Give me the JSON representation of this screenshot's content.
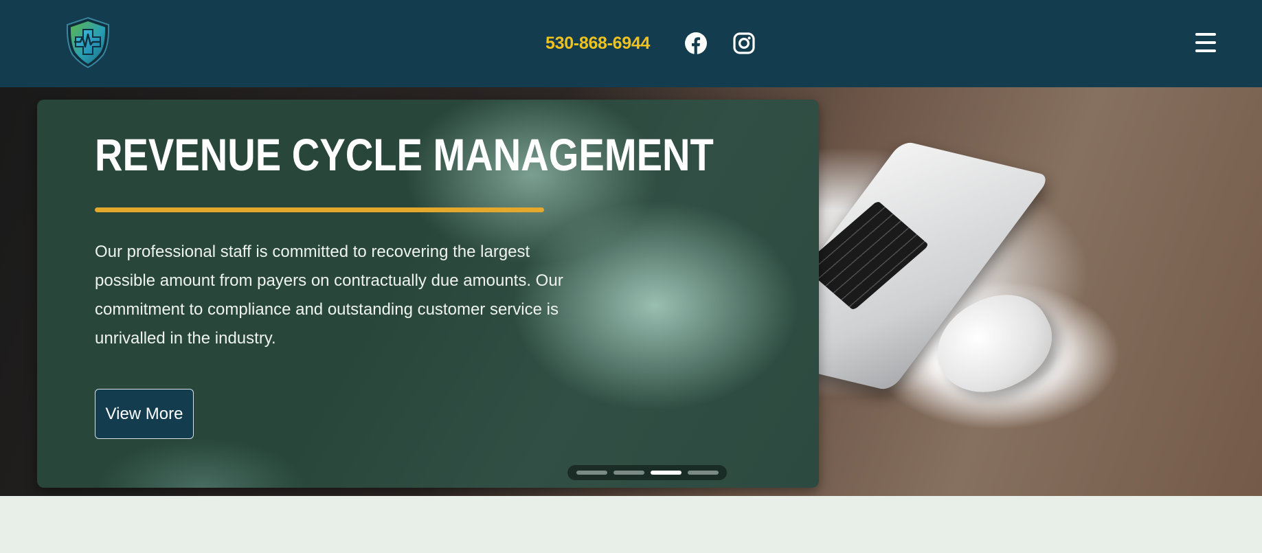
{
  "header": {
    "logo": "medical-shield-logo-icon",
    "phone": "530-868-6944",
    "social": [
      {
        "name": "facebook-icon"
      },
      {
        "name": "instagram-icon"
      }
    ],
    "menu_icon": "hamburger-menu-icon",
    "colors": {
      "background": "#133d4e",
      "phone": "#f0c21d"
    }
  },
  "hero": {
    "title": "REVENUE CYCLE MANAGEMENT",
    "description": "Our professional staff is committed to recovering the largest possible amount from payers on contractually due amounts. Our commitment to compliance and outstanding customer service is unrivalled in the industry.",
    "cta_label": "View More",
    "accent_color": "#e3a82c",
    "slides": {
      "count": 4,
      "active_index": 2
    }
  }
}
